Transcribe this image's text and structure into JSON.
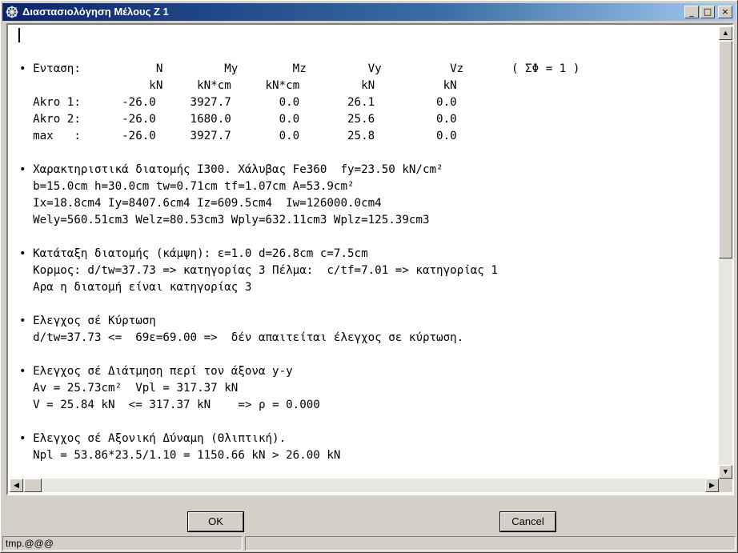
{
  "window": {
    "title": "Διαστασιολόγηση Μέλους Z 1",
    "app_icon": "steering-wheel-icon",
    "controls": {
      "minimize": "_",
      "maximize": "□",
      "close": "×"
    }
  },
  "report": {
    "lines": [
      "• Ενταση:           N         My        Mz         Vy          Vz       ( ΣΦ = 1 )",
      "                   kN     kN*cm     kN*cm         kN          kN",
      "  Akro 1:      -26.0     3927.7       0.0       26.1         0.0",
      "  Akro 2:      -26.0     1680.0       0.0       25.6         0.0",
      "  max   :      -26.0     3927.7       0.0       25.8         0.0",
      "",
      "• Χαρακτηριστικά διατομής I300. Χάλυβας Fe360  fy=23.50 kN/cm²",
      "  b=15.0cm h=30.0cm tw=0.71cm tf=1.07cm A=53.9cm²",
      "  Ix=18.8cm4 Iy=8407.6cm4 Iz=609.5cm4  Iw=126000.0cm4",
      "  Wely=560.51cm3 Welz=80.53cm3 Wply=632.11cm3 Wplz=125.39cm3",
      "",
      "• Κατάταξη διατομής (κάμψη): ε=1.0 d=26.8cm c=7.5cm",
      "  Κορμος: d/tw=37.73 => κατηγορίας 3 Πέλμα:  c/tf=7.01 => κατηγορίας 1",
      "  Αρα η διατομή είναι κατηγορίας 3",
      "",
      "• Ελεγχος σέ Κύρτωση",
      "  d/tw=37.73 <=  69ε=69.00 =>  δέν απαιτείται έλεγχος σε κύρτωση.",
      "",
      "• Ελεγχος σέ Διάτμηση περί τον άξονα y-y",
      "  Av = 25.73cm²  Vpl = 317.37 kN",
      "  V = 25.84 kN  <= 317.37 kN    => ρ = 0.000",
      "",
      "• Ελεγχος σέ Αξονική Δύναμη (Θλιπτική).",
      "  Npl = 53.86*23.5/1.10 = 1150.66 kN > 26.00 kN"
    ]
  },
  "buttons": {
    "ok": "OK",
    "cancel": "Cancel"
  },
  "status": {
    "left": "tmp.@@@",
    "right": ""
  },
  "scrollbar": {
    "up": "▲",
    "down": "▼",
    "left": "◀",
    "right": "▶"
  }
}
